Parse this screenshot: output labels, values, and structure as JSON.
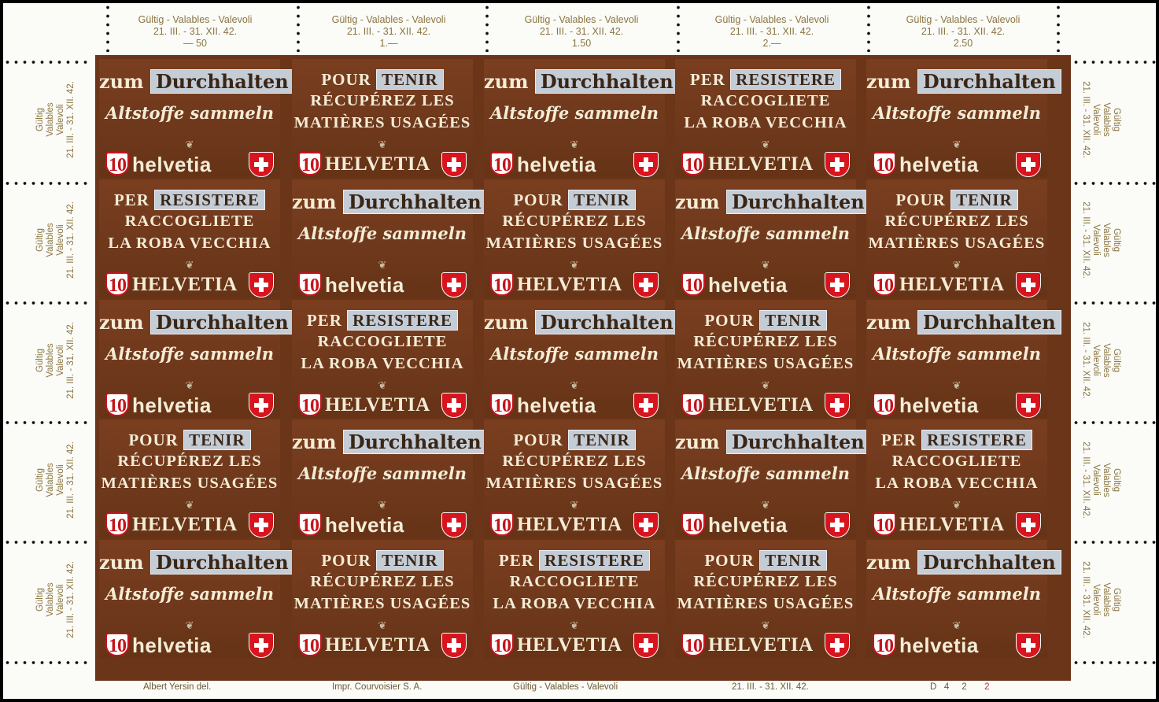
{
  "top_labels": [
    {
      "line1": "Gültig - Valables - Valevoli",
      "line2": "21. III. - 31. XII. 42.",
      "value": "— 50"
    },
    {
      "line1": "Gültig - Valables - Valevoli",
      "line2": "21. III. - 31. XII. 42.",
      "value": "1.—"
    },
    {
      "line1": "Gültig - Valables - Valevoli",
      "line2": "21. III. - 31. XII. 42.",
      "value": "1.50"
    },
    {
      "line1": "Gültig - Valables - Valevoli",
      "line2": "21. III. - 31. XII. 42.",
      "value": "2.—"
    },
    {
      "line1": "Gültig - Valables - Valevoli",
      "line2": "21. III. - 31. XII. 42.",
      "value": "2.50"
    }
  ],
  "side_label": {
    "line1": "Gültig",
    "line2": "Valables",
    "line3": "Valevoli",
    "line4": "21. III. - 31. XII. 42."
  },
  "stamp_texts": {
    "ger": {
      "l1a": "zum",
      "l1b": "Durchhalten",
      "l2": "Altstoffe sammeln",
      "country": "helvetia"
    },
    "fra": {
      "l1a": "POUR",
      "l1b": "TENIR",
      "l2": "RÉCUPÉREZ LES",
      "l3": "MATIÈRES USAGÉES",
      "country": "HELVETIA"
    },
    "ita": {
      "l1a": "PER",
      "l1b": "RESISTERE",
      "l2": "RACCOGLIETE",
      "l3": "LA ROBA VECCHIA",
      "country": "HELVETIA"
    },
    "denomination": "10"
  },
  "grid": [
    [
      "ger",
      "fra",
      "ger",
      "ita",
      "ger"
    ],
    [
      "ita",
      "ger",
      "fra",
      "ger",
      "fra"
    ],
    [
      "ger",
      "ita",
      "ger",
      "fra",
      "ger"
    ],
    [
      "fra",
      "ger",
      "fra",
      "ger",
      "ita"
    ],
    [
      "ger",
      "fra",
      "ita",
      "fra",
      "ger"
    ]
  ],
  "footer": {
    "designer": "Albert Yersin   del.",
    "printer": "Impr. Courvoisier S. A.",
    "validity": "Gültig - Valables - Valevoli",
    "dates": "21. III. - 31. XII. 42.",
    "plate_letter": "D",
    "plate_n1": "4",
    "plate_n2": "2",
    "plate_n3": "2"
  },
  "colors": {
    "stamp_brown": "#6e381c",
    "label_box": "#c4ccd6",
    "shield_red": "#d8141e",
    "sheet": "#fbfbf8"
  }
}
